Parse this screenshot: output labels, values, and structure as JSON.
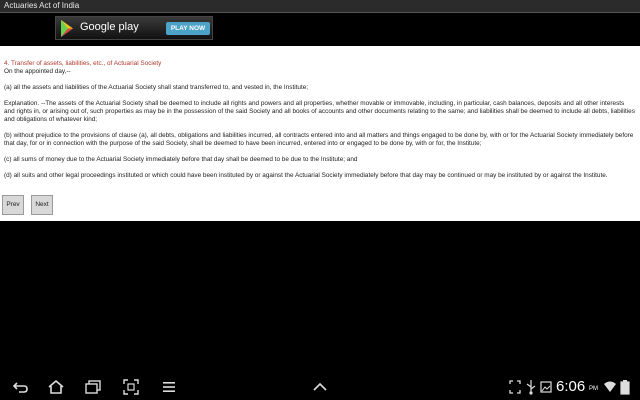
{
  "app": {
    "title": "Actuaries Act of India"
  },
  "ad": {
    "store_name": "Google play",
    "cta_label": "PLAY NOW"
  },
  "content": {
    "heading": "4. Transfer of assets, liabilities, etc., of Actuarial Society",
    "intro": "On the appointed day,--",
    "paragraphs": [
      "(a) all the assets and liabilities of the Actuarial Society shall stand transferred to, and vested in, the Institute;",
      "Explanation. --The assets of the Actuarial Society shall be deemed to include all rights and powers and all properties, whether movable or immovable, including, in particular, cash balances, deposits and all other interests and rights in, or arising out of, such properties as may be in the possession of the said Society and all books of accounts and other documents relating to the same; and liabilities shall be deemed to include all debts, liabilities and obligations of whatever kind;",
      "(b) without prejudice to the provisions of clause (a), all debts, obligations and liabilities incurred, all contracts entered into and all matters and things engaged to be done by, with or for the Actuarial Society immediately before that day, for or in connection with the purpose of the said Society, shall be deemed to have been incurred, entered into or engaged to be done by, with or for, the Institute;",
      "(c) all sums of money due to the Actuarial Society immediately before that day shall be deemed to be due to the Institute; and",
      "(d) all suits and other legal proceedings instituted or which could have been instituted by or against the Actuarial Society immediately before that day may be continued or may be instituted by or against the Institute."
    ]
  },
  "buttons": {
    "prev": "Prev",
    "next": "Next"
  },
  "status": {
    "time": "6:06",
    "ampm": "PM"
  },
  "colors": {
    "heading": "#b03a2e",
    "play_button": "#4da3c7"
  },
  "icons": [
    "back-icon",
    "home-icon",
    "recent-apps-icon",
    "screenshot-icon",
    "menu-icon",
    "up-chevron-icon",
    "fullscreen-icon",
    "usb-icon",
    "image-icon",
    "wifi-icon",
    "battery-icon"
  ]
}
